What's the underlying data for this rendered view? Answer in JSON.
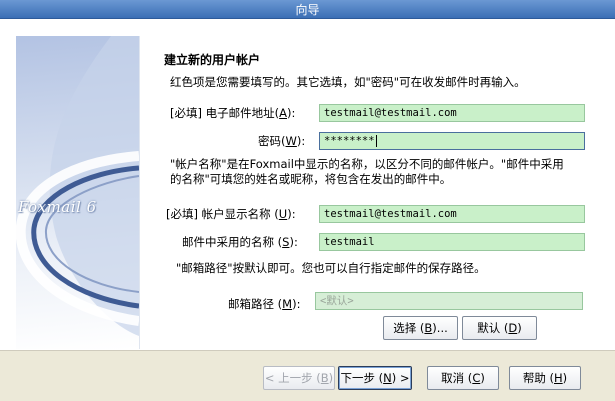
{
  "window": {
    "title": "向导"
  },
  "page": {
    "heading": "建立新的用户帐户",
    "intro": "红色项是您需要填写的。其它选填，如\"密码\"可在收发邮件时再输入。",
    "note1_line1": "\"帐户名称\"是在Foxmail中显示的名称，以区分不同的邮件帐户。\"邮件中采用",
    "note1_line2": "的名称\"可填您的姓名或昵称，将包含在发出的邮件中。",
    "note2": "\"邮箱路径\"按默认即可。您也可以自行指定邮件的保存路径。"
  },
  "banner": {
    "logo": "Foxmail 6"
  },
  "form": {
    "email": {
      "label_pre": "[必填] 电子邮件地址(",
      "key": "A",
      "label_post": "):",
      "value": "testmail@testmail.com"
    },
    "password": {
      "label_pre": "密码(",
      "key": "W",
      "label_post": "):",
      "value": "********"
    },
    "account_name": {
      "label_pre": "[必填] 帐户显示名称 (",
      "key": "U",
      "label_post": "):",
      "value": "testmail@testmail.com"
    },
    "sender_name": {
      "label_pre": "邮件中采用的名称 (",
      "key": "S",
      "label_post": "):",
      "value": "testmail"
    },
    "mailbox_path": {
      "label_pre": "邮箱路径 (",
      "key": "M",
      "label_post": "):",
      "value": "<默认>"
    }
  },
  "buttons": {
    "browse": {
      "pre": "选择 (",
      "key": "B",
      "post": ")..."
    },
    "default": {
      "pre": "默认 (",
      "key": "D",
      "post": ")"
    },
    "back": {
      "pre": "< 上一步 (",
      "key": "B",
      "post": ")"
    },
    "next": {
      "pre": "下一步 (",
      "key": "N",
      "post": ") >"
    },
    "cancel": {
      "pre": "取消 (",
      "key": "C",
      "post": ")"
    },
    "help": {
      "pre": "帮助 (",
      "key": "H",
      "post": ")"
    }
  }
}
